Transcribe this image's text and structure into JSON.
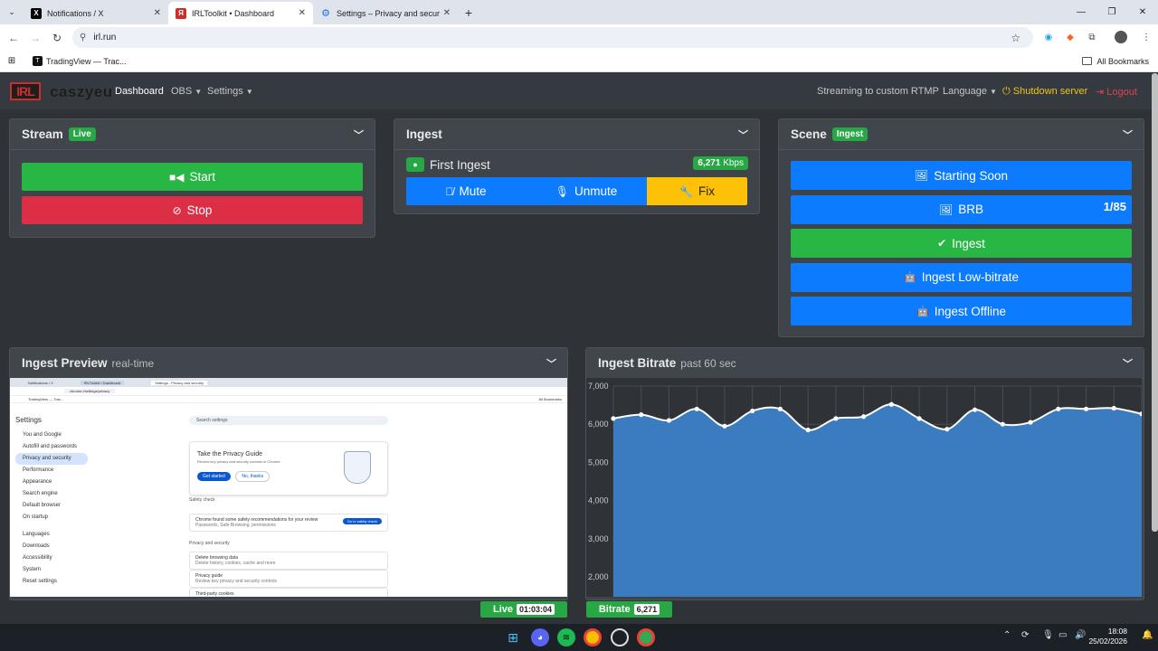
{
  "browser": {
    "tabs": [
      {
        "title": "Notifications / X",
        "icon": "x-icon"
      },
      {
        "title": "IRLToolkit • Dashboard",
        "icon": "irltoolkit-icon"
      },
      {
        "title": "Settings – Privacy and security",
        "icon": "gear-icon"
      }
    ],
    "active_tab": 1,
    "url": "irl.run",
    "bookmarks": [
      {
        "title": "TradingView — Trac..."
      }
    ],
    "all_bookmarks": "All Bookmarks"
  },
  "nav": {
    "logo_text": "IRL",
    "username": "caszyeu",
    "links": {
      "dashboard": "Dashboard",
      "obs": "OBS",
      "settings": "Settings"
    },
    "status": "Streaming to custom RTMP",
    "language": "Language",
    "shutdown": "Shutdown server",
    "logout": "Logout"
  },
  "stream_card": {
    "title": "Stream",
    "badge": "Live",
    "start_label": "Start",
    "stop_label": "Stop"
  },
  "ingest_card": {
    "title": "Ingest",
    "ingest_name": "First Ingest",
    "kbps_value": "6,271",
    "kbps_unit": "Kbps",
    "mute_label": "Mute",
    "unmute_label": "Unmute",
    "fix_label": "Fix"
  },
  "scene_card": {
    "title": "Scene",
    "badge": "Ingest",
    "scenes": [
      {
        "label": "Starting Soon",
        "icon": "image-icon",
        "active": false,
        "count": ""
      },
      {
        "label": "BRB",
        "icon": "image-icon",
        "active": false,
        "count": "1/85"
      },
      {
        "label": "Ingest",
        "icon": "check-icon",
        "active": true,
        "count": ""
      },
      {
        "label": "Ingest Low-bitrate",
        "icon": "robot-icon",
        "active": false,
        "count": ""
      },
      {
        "label": "Ingest Offline",
        "icon": "robot-icon",
        "active": false,
        "count": ""
      }
    ]
  },
  "preview_card": {
    "title": "Ingest Preview",
    "subtitle": "real-time",
    "preview": {
      "tabs": [
        "Notifications / X",
        "IRLToolkit • Dashboard",
        "Settings - Privacy and security"
      ],
      "url": "chrome://settings/privacy",
      "bookmark": "TradingView — Trac...",
      "all_bookmarks": "All Bookmarks",
      "settings_title": "Settings",
      "search_placeholder": "Search settings",
      "menu": [
        "You and Google",
        "Autofill and passwords",
        "Privacy and security",
        "Performance",
        "Appearance",
        "Search engine",
        "Default browser",
        "On startup",
        "Languages",
        "Downloads",
        "Accessibility",
        "System",
        "Reset settings"
      ],
      "guide_title": "Take the Privacy Guide",
      "guide_desc": "Review key privacy and security controls in Chrome",
      "guide_start": "Get started",
      "guide_no": "No, thanks",
      "safety_label": "Safety check",
      "safety_text": "Chrome found some safety recommendations for your review",
      "safety_sub": "Passwords, Safe Browsing, permissions",
      "safety_btn": "Go to safety check",
      "privacy_label": "Privacy and security",
      "rows": [
        {
          "title": "Delete browsing data",
          "sub": "Delete history, cookies, cache and more"
        },
        {
          "title": "Privacy guide",
          "sub": "Review key privacy and security controls"
        },
        {
          "title": "Third-party cookies",
          "sub": ""
        }
      ]
    }
  },
  "bitrate_card": {
    "title": "Ingest Bitrate",
    "subtitle": "past 60 sec"
  },
  "chart_data": {
    "type": "area",
    "title": "Ingest Bitrate",
    "subtitle": "past 60 sec",
    "x": [
      0,
      1,
      2,
      3,
      4,
      5,
      6,
      7,
      8,
      9,
      10,
      11,
      12,
      13,
      14,
      15,
      16,
      17,
      18,
      19
    ],
    "values": [
      6150,
      6250,
      6100,
      6400,
      5950,
      6350,
      6400,
      5850,
      6150,
      6200,
      6520,
      6150,
      5870,
      6380,
      6000,
      6050,
      6400,
      6400,
      6420,
      6271
    ],
    "ylim": [
      1750,
      7000
    ],
    "yticks": [
      "7,000",
      "6,000",
      "5,000",
      "4,000",
      "3,000",
      "2,000"
    ],
    "color": "#3b7bbf",
    "grid": true
  },
  "status": {
    "live_label": "Live",
    "live_time": "01:03:04",
    "bitrate_label": "Bitrate",
    "bitrate_value": "6,271"
  },
  "taskbar": {
    "time": "18:08",
    "date": "25/02/2026"
  }
}
